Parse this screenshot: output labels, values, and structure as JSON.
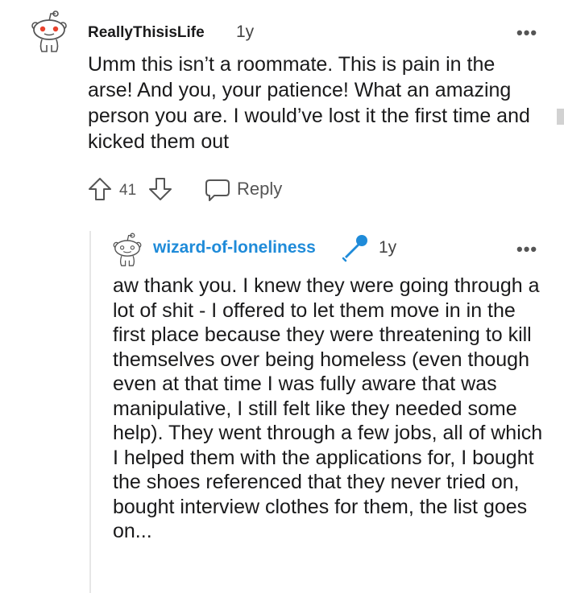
{
  "comment": {
    "username": "ReallyThisisLife",
    "age": "1y",
    "more_label": "•••",
    "body": "Umm this isn’t a roommate. This is pain in the arse! And you, your patience! What an amazing person you are. I would’ve lost it the first time and kicked them out",
    "vote_count": "41",
    "reply_label": "Reply"
  },
  "reply": {
    "username": "wizard-of-loneliness",
    "age": "1y",
    "more_label": "•••",
    "flair_icon": "microphone-icon",
    "body": "aw thank you. I knew they were going through a lot of shit - I offered to let them move in in the first place because they were threatening to kill themselves over being homeless (even though even at that time I was fully aware that was manipulative, I still felt like they needed some help). They went through a few jobs, all of which I helped them with the applications for, I bought the shoes referenced that they never tried on, bought interview clothes for them, the list goes on..."
  },
  "colors": {
    "accent_blue": "#1f8bd9",
    "avatar_red": "#e8412c",
    "text": "#1a1a1b",
    "muted": "#555555"
  }
}
